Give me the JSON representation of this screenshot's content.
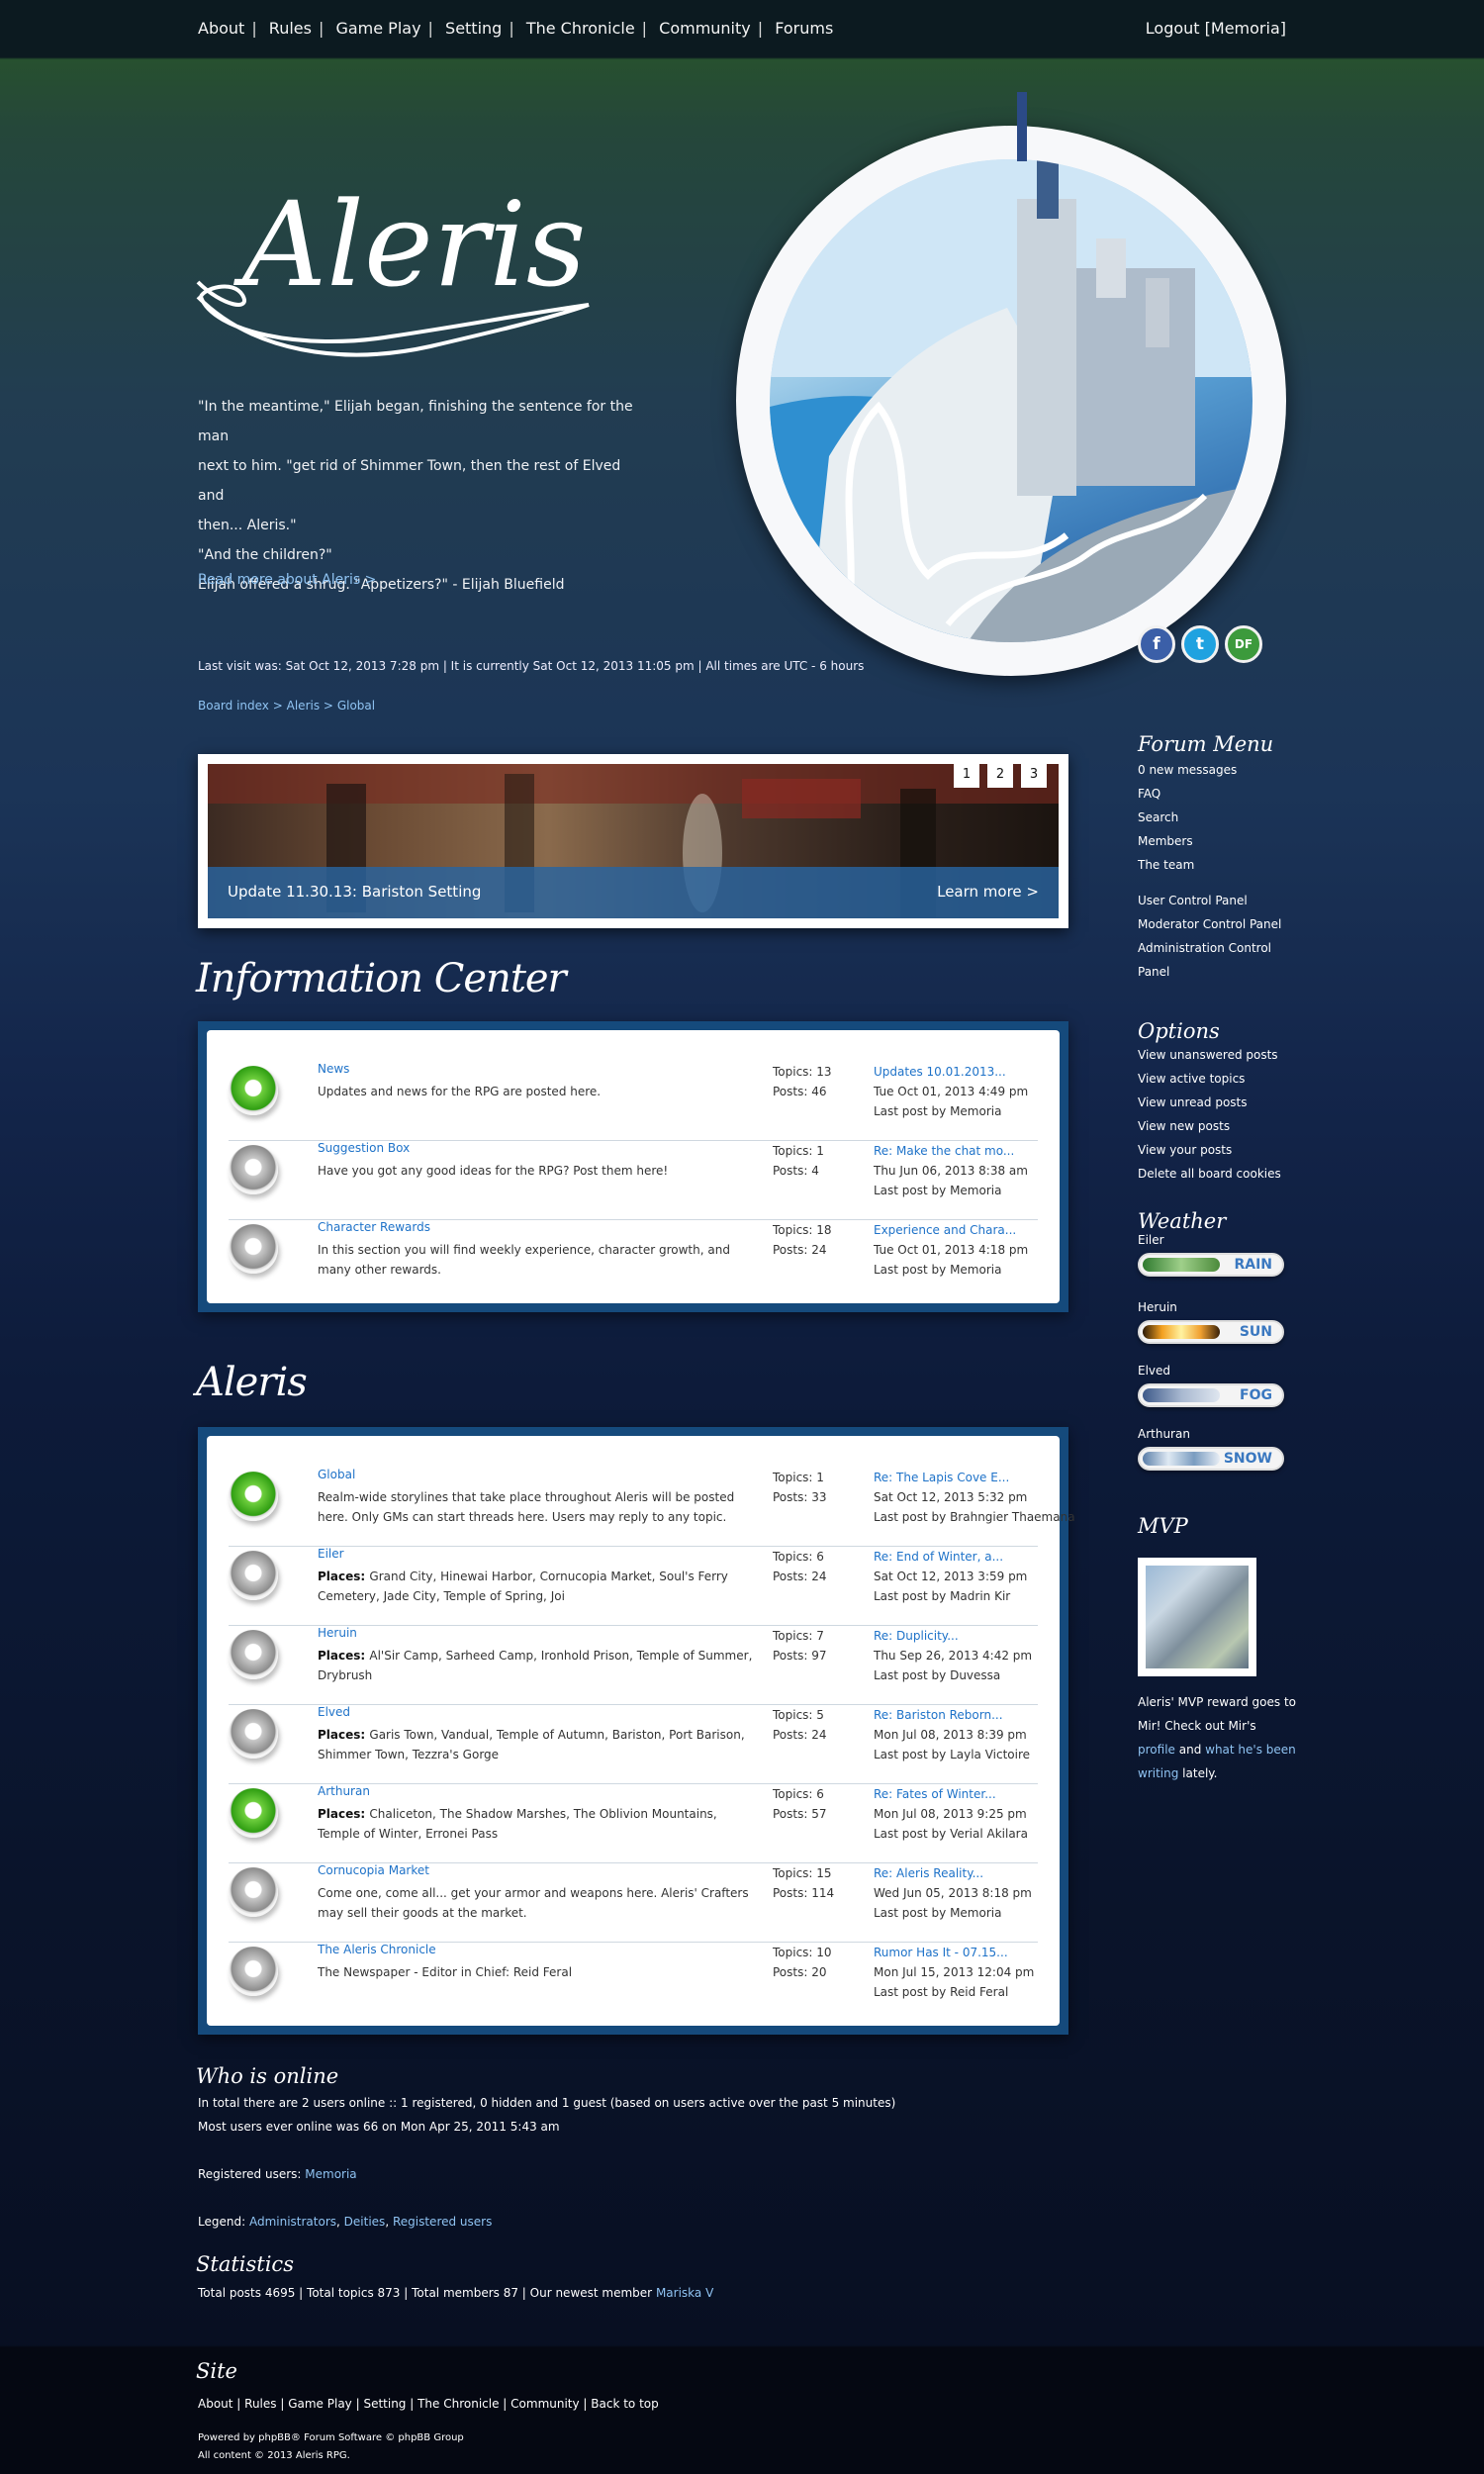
{
  "nav": {
    "items": [
      "About",
      "Rules",
      "Game Play",
      "Setting",
      "The Chronicle",
      "Community",
      "Forums"
    ],
    "logout": "Logout [Memoria]"
  },
  "header": {
    "logo": "Aleris",
    "quote": [
      "\"In the meantime,\" Elijah began, finishing the sentence for the man",
      "next to him. \"get rid of Shimmer Town, then the rest of Elved and",
      "then... Aleris.\"",
      "\"And the children?\"",
      "Elijah offered a shrug. \"Appetizers?\" - Elijah Bluefield"
    ],
    "read_more": "Read more about Aleris >",
    "social": [
      "f",
      "t",
      "DF"
    ]
  },
  "visit_info": "Last visit was: Sat Oct 12, 2013 7:28 pm | It is currently Sat Oct 12, 2013 11:05 pm | All times are UTC - 6 hours",
  "breadcrumb": [
    "Board index",
    "Aleris",
    "Global"
  ],
  "slider": {
    "caption": "Update 11.30.13: Bariston Setting",
    "learn_more": "Learn more >",
    "pages": [
      "1",
      "2",
      "3"
    ]
  },
  "info_center": {
    "title": "Information Center",
    "forums": [
      {
        "name": "News",
        "desc": "Updates and news for the RPG are posted here.",
        "places": false,
        "icon": "green",
        "topics": "Topics: 13",
        "posts": "Posts: 46",
        "last_title": "Updates 10.01.2013...",
        "last_date": "Tue Oct 01, 2013 4:49 pm",
        "last_by": "Last post by Memoria"
      },
      {
        "name": "Suggestion Box",
        "desc": "Have you got any good ideas for the RPG? Post them here!",
        "places": false,
        "icon": "grey",
        "topics": "Topics: 1",
        "posts": "Posts: 4",
        "last_title": "Re: Make the chat mo...",
        "last_date": "Thu Jun 06, 2013 8:38 am",
        "last_by": "Last post by Memoria"
      },
      {
        "name": "Character Rewards",
        "desc": "In this section you will find weekly experience, character growth, and many other rewards.",
        "places": false,
        "icon": "grey",
        "topics": "Topics: 18",
        "posts": "Posts: 24",
        "last_title": "Experience and Chara...",
        "last_date": "Tue Oct 01, 2013 4:18 pm",
        "last_by": "Last post by Memoria"
      }
    ]
  },
  "aleris": {
    "title": "Aleris",
    "forums": [
      {
        "name": "Global",
        "desc": "Realm-wide storylines that take place throughout Aleris will be posted here. Only GMs can start threads here. Users may reply to any topic.",
        "places": false,
        "icon": "green",
        "topics": "Topics: 1",
        "posts": "Posts: 33",
        "last_title": "Re: The Lapis Cove E...",
        "last_date": "Sat Oct 12, 2013 5:32 pm",
        "last_by": "Last post by Brahngier Thaemana"
      },
      {
        "name": "Eiler",
        "desc": "Grand City, Hinewai Harbor, Cornucopia Market, Soul's Ferry Cemetery, Jade City, Temple of Spring, Joi",
        "places": true,
        "icon": "grey",
        "topics": "Topics: 6",
        "posts": "Posts: 24",
        "last_title": "Re: End of Winter, a...",
        "last_date": "Sat Oct 12, 2013 3:59 pm",
        "last_by": "Last post by Madrin Kir"
      },
      {
        "name": "Heruin",
        "desc": "Al'Sir Camp, Sarheed Camp, Ironhold Prison, Temple of Summer, Drybrush",
        "places": true,
        "icon": "grey",
        "topics": "Topics: 7",
        "posts": "Posts: 97",
        "last_title": "Re: Duplicity...",
        "last_date": "Thu Sep 26, 2013 4:42 pm",
        "last_by": "Last post by Duvessa"
      },
      {
        "name": "Elved",
        "desc": "Garis Town, Vandual, Temple of Autumn, Bariston, Port Barison, Shimmer Town, Tezzra's Gorge",
        "places": true,
        "icon": "grey",
        "topics": "Topics: 5",
        "posts": "Posts: 24",
        "last_title": "Re: Bariston Reborn...",
        "last_date": "Mon Jul 08, 2013 8:39 pm",
        "last_by": "Last post by Layla Victoire"
      },
      {
        "name": "Arthuran",
        "desc": "Chaliceton, The Shadow Marshes, The Oblivion Mountains, Temple of Winter, Erronei Pass",
        "places": true,
        "icon": "green",
        "topics": "Topics: 6",
        "posts": "Posts: 57",
        "last_title": "Re: Fates of Winter...",
        "last_date": "Mon Jul 08, 2013 9:25 pm",
        "last_by": "Last post by Verial Akilara"
      },
      {
        "name": "Cornucopia Market",
        "desc": "Come one, come all... get your armor and weapons here. Aleris' Crafters may sell their goods at the market.",
        "places": false,
        "icon": "grey",
        "topics": "Topics: 15",
        "posts": "Posts: 114",
        "last_title": "Re: Aleris Reality...",
        "last_date": "Wed Jun 05, 2013 8:18 pm",
        "last_by": "Last post by Memoria"
      },
      {
        "name": "The Aleris Chronicle",
        "desc": "The Newspaper - Editor in Chief: Reid Feral",
        "places": false,
        "icon": "grey",
        "topics": "Topics: 10",
        "posts": "Posts: 20",
        "last_title": "Rumor Has It - 07.15...",
        "last_date": "Mon Jul 15, 2013 12:04 pm",
        "last_by": "Last post by Reid Feral"
      }
    ]
  },
  "places_label": "Places:",
  "sidebar": {
    "menu_title": "Forum Menu",
    "menu": [
      "0 new messages",
      "FAQ",
      "Search",
      "Members",
      "The team"
    ],
    "panels": [
      "User Control Panel",
      "Moderator Control Panel",
      "Administration Control",
      "Panel"
    ],
    "options_title": "Options",
    "options": [
      "View unanswered posts",
      "View active topics",
      "View unread posts",
      "View new posts",
      "View your posts",
      "Delete all board cookies"
    ],
    "weather_title": "Weather",
    "weather": [
      {
        "region": "Eiler",
        "label": "RAIN"
      },
      {
        "region": "Heruin",
        "label": "SUN"
      },
      {
        "region": "Elved",
        "label": "FOG"
      },
      {
        "region": "Arthuran",
        "label": "SNOW"
      }
    ],
    "mvp_title": "MVP",
    "mvp_line1": "Aleris' MVP reward goes to",
    "mvp_line2": "Mir! Check out Mir's",
    "mvp_profile": "profile",
    "mvp_and": "and",
    "mvp_writing1": "what he's been",
    "mvp_writing2": "writing",
    "mvp_end": "lately."
  },
  "online": {
    "title": "Who is online",
    "line1": "In total there are 2 users online :: 1 registered, 0 hidden and 1 guest (based on users active over the past 5 minutes)",
    "line2": "Most users ever online was 66 on Mon Apr 25, 2011 5:43 am",
    "registered_label": "Registered users:",
    "registered_user": "Memoria",
    "legend_label": "Legend:",
    "legend": [
      "Administrators",
      "Deities",
      "Registered users"
    ]
  },
  "statistics": {
    "title": "Statistics",
    "text": "Total posts 4695 | Total topics 873 | Total members 87 | Our newest member",
    "newest": "Mariska V"
  },
  "footer": {
    "title": "Site",
    "links": [
      "About",
      "Rules",
      "Game Play",
      "Setting",
      "The Chronicle",
      "Community",
      "Back to top"
    ],
    "powered": "Powered by phpBB® Forum Software © phpBB Group",
    "copyright": "All content © 2013 Aleris RPG."
  }
}
